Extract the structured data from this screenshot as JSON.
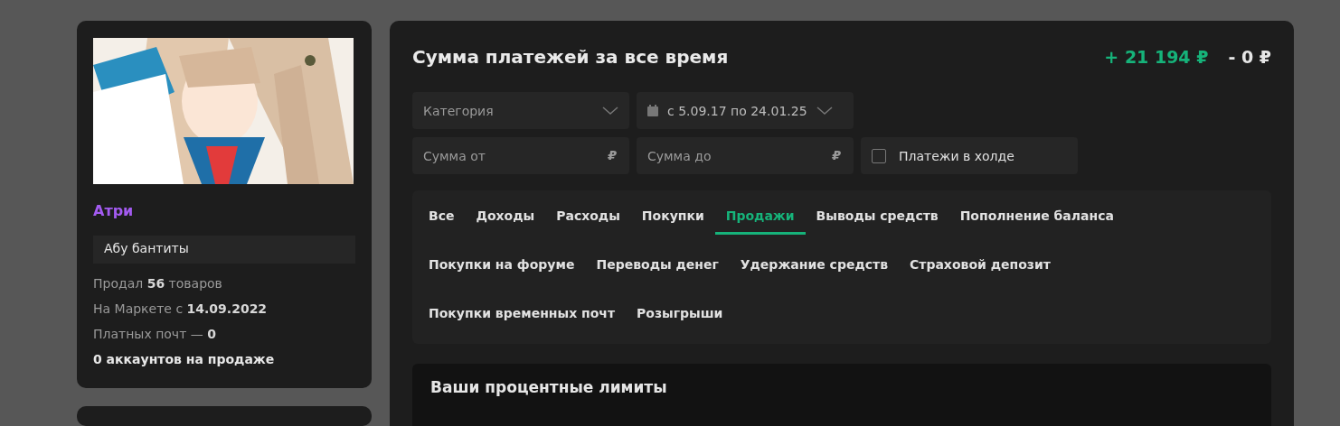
{
  "profile": {
    "name": "Атри",
    "status": "Абу бантиты",
    "stats": [
      {
        "text": "Продал **56** товаров",
        "kind": "normal"
      },
      {
        "text": "На Маркете с **14.09.2022**",
        "kind": "normal"
      },
      {
        "text": "Платных почт — **0**",
        "kind": "normal"
      },
      {
        "text": "0 аккаунтов на продаже",
        "kind": "bold"
      }
    ]
  },
  "payments": {
    "title": "Сумма платежей за все время",
    "income": "+ 21 194 ₽",
    "expense": "- 0 ₽",
    "filters": {
      "category": {
        "placeholder": "Категория"
      },
      "date_range": {
        "value": "с 5.09.17 по 24.01.25"
      },
      "amount_from": {
        "placeholder": "Сумма от",
        "currency": "₽"
      },
      "amount_to": {
        "placeholder": "Сумма до",
        "currency": "₽"
      },
      "on_hold": {
        "label": "Платежи в холде",
        "checked": false
      }
    },
    "tabs": [
      {
        "label": "Все",
        "selected": false
      },
      {
        "label": "Доходы",
        "selected": false
      },
      {
        "label": "Расходы",
        "selected": false
      },
      {
        "label": "Покупки",
        "selected": false
      },
      {
        "label": "Продажи",
        "selected": true
      },
      {
        "label": "Выводы средств",
        "selected": false
      },
      {
        "label": "Пополнение баланса",
        "selected": false
      },
      {
        "label": "Покупки на форуме",
        "selected": false
      },
      {
        "label": "Переводы денег",
        "selected": false
      },
      {
        "label": "Удержание средств",
        "selected": false
      },
      {
        "label": "Страховой депозит",
        "selected": false
      },
      {
        "label": "Покупки временных почт",
        "selected": false
      },
      {
        "label": "Розыгрыши",
        "selected": false
      }
    ],
    "limits": {
      "title": "Ваши процентные лимиты"
    }
  }
}
